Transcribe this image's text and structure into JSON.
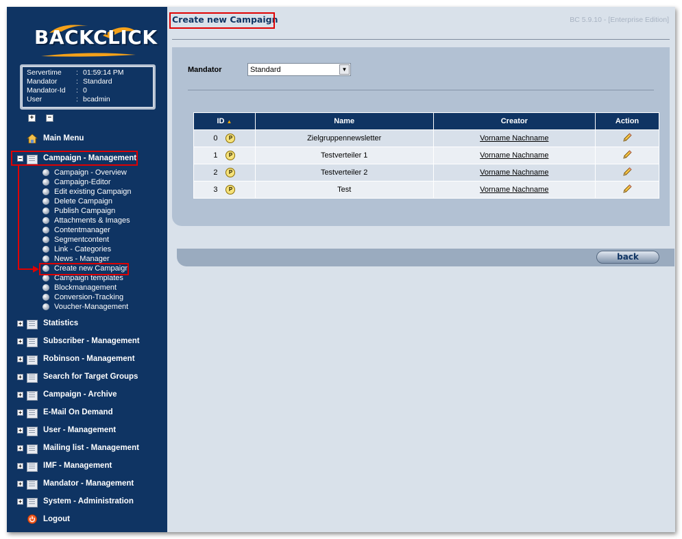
{
  "sidebar": {
    "logo_text": "BACKCLICK",
    "info": [
      {
        "key": "Servertime",
        "value": "01:59:14 PM"
      },
      {
        "key": "Mandator",
        "value": "Standard"
      },
      {
        "key": "Mandator-Id",
        "value": "0"
      },
      {
        "key": "User",
        "value": "bcadmin"
      }
    ],
    "expand_all": "+",
    "collapse_all": "−",
    "main_menu": "Main Menu",
    "campaign_management": "Campaign - Management",
    "campaign_items": [
      "Campaign - Overview",
      "Campaign-Editor",
      "Edit existing Campaign",
      "Delete Campaign",
      "Publish Campaign",
      "Attachments & Images",
      "Contentmanager",
      "Segmentcontent",
      "Link - Categories",
      "News - Manager",
      "Create new Campaign",
      "Campaign templates",
      "Blockmanagement",
      "Conversion-Tracking",
      "Voucher-Management"
    ],
    "sections": [
      "Statistics",
      "Subscriber - Management",
      "Robinson - Management",
      "Search for Target Groups",
      "Campaign - Archive",
      "E-Mail On Demand",
      "User - Management",
      "Mailing list - Management",
      "IMF - Management",
      "Mandator - Management",
      "System - Administration"
    ],
    "logout": "Logout"
  },
  "main": {
    "title": "Create new Campaign",
    "version": "BC 5.9.10 - [Enterprise Edition]",
    "mandator_label": "Mandator",
    "mandator_value": "Standard",
    "table": {
      "headers": [
        "ID",
        "Name",
        "Creator",
        "Action"
      ],
      "rows": [
        {
          "id": "0",
          "name": "Zielgruppennewsletter",
          "creator": "Vorname Nachname"
        },
        {
          "id": "1",
          "name": "Testverteiler 1",
          "creator": "Vorname Nachname"
        },
        {
          "id": "2",
          "name": "Testverteiler 2",
          "creator": "Vorname Nachname"
        },
        {
          "id": "3",
          "name": "Test",
          "creator": "Vorname Nachname"
        }
      ],
      "badge": "P"
    },
    "back_label": "back"
  },
  "colors": {
    "sidebar_bg": "#0f3463",
    "main_bg": "#d9e1ea",
    "panel_bg": "#b2c1d3",
    "highlight": "#e00000"
  }
}
